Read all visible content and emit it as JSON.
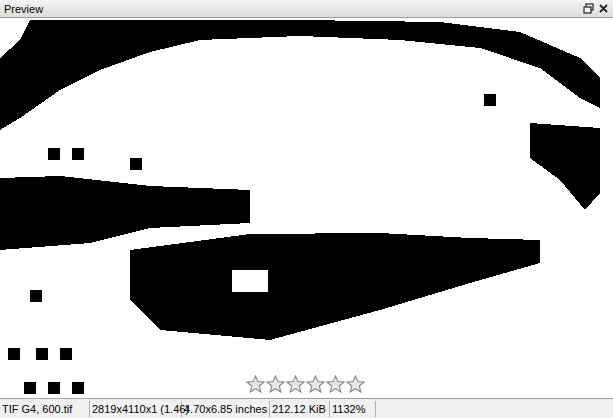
{
  "panel": {
    "title": "Preview"
  },
  "rating": {
    "stars": 0
  },
  "status_bar": [
    "TIF G4, 600.tif",
    "2819x4110x1 (1.46)",
    "4.70x6.85 inches",
    "212.12 KiB",
    "1132%"
  ]
}
